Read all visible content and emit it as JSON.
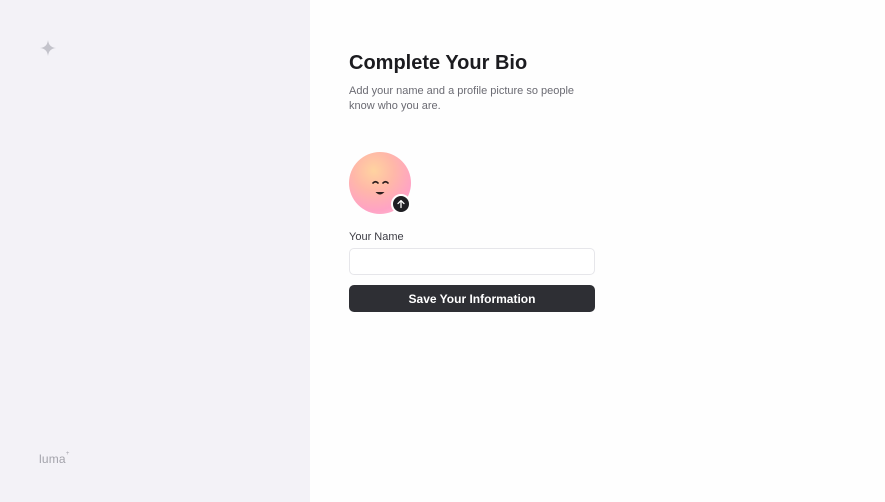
{
  "sidebar": {
    "icon": "sparkle-icon",
    "brand": "luma",
    "brand_mark": "+"
  },
  "main": {
    "title": "Complete Your Bio",
    "subtitle": "Add your name and a profile picture so people know who you are.",
    "avatar": {
      "icon": "smiley-face-avatar",
      "upload_icon": "arrow-up-icon"
    },
    "name_field": {
      "label": "Your Name",
      "value": "",
      "placeholder": ""
    },
    "save_label": "Save Your Information"
  },
  "colors": {
    "sidebar_bg": "#f3f2f7",
    "button_bg": "#2e2f34",
    "title": "#1b1b1f",
    "muted_text": "#6b6b73"
  }
}
